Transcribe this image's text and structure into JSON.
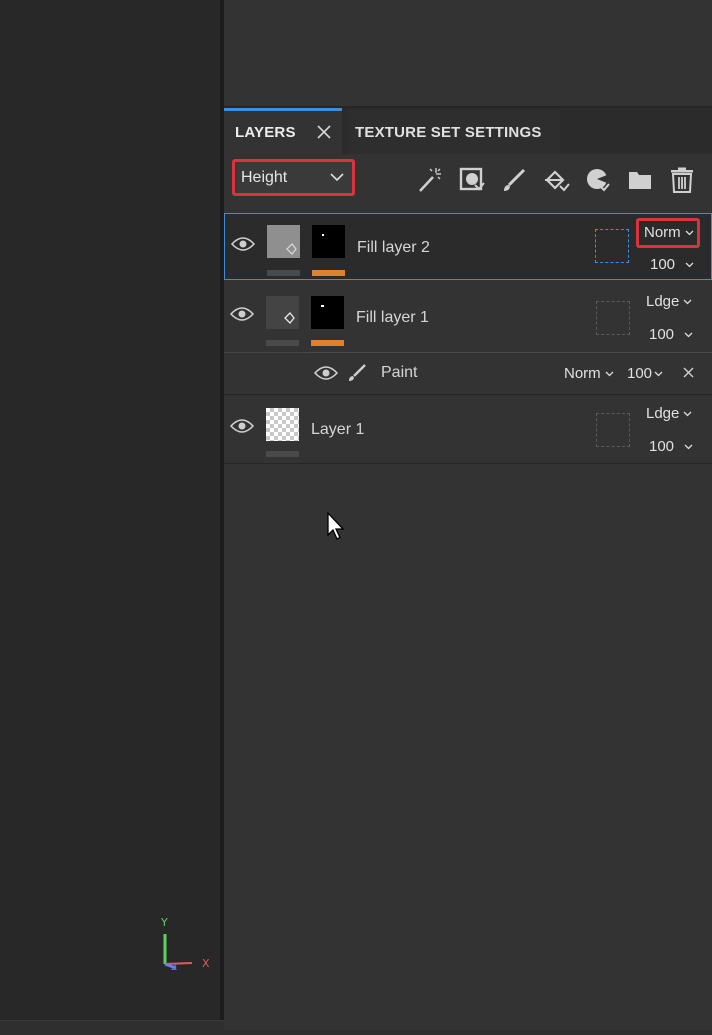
{
  "panel": {
    "tabs": [
      {
        "label": "LAYERS",
        "active": true
      },
      {
        "label": "TEXTURE SET SETTINGS",
        "active": false
      }
    ]
  },
  "toolbar": {
    "channel": "Height",
    "tools": [
      "magic-wand-icon",
      "add-mask-icon",
      "paint-brush-icon",
      "fill-bucket-icon",
      "smart-material-icon",
      "folder-icon",
      "trash-icon"
    ]
  },
  "layers": [
    {
      "name": "Fill layer 2",
      "blend": "Norm",
      "opacity": "100",
      "selected": true,
      "highlight_blend": true
    },
    {
      "name": "Fill layer 1",
      "blend": "Ldge",
      "opacity": "100",
      "selected": false,
      "effects": [
        {
          "name": "Paint",
          "blend": "Norm",
          "opacity": "100"
        }
      ]
    },
    {
      "name": "Layer 1",
      "blend": "Ldge",
      "opacity": "100",
      "selected": false
    }
  ],
  "viewport": {
    "axes": [
      "Y",
      "X",
      "Z"
    ]
  },
  "colors": {
    "accent": "#3d8ee0",
    "highlight": "#d9333f",
    "fill_indicator": "#e0822b"
  }
}
